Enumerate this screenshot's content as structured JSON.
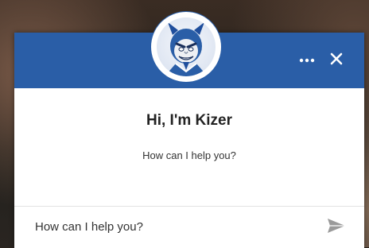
{
  "chat": {
    "greeting": "Hi, I'm Kizer",
    "prompt": "How can I help you?",
    "input_placeholder": "How can I help you?"
  },
  "header": {
    "avatar_icon": "blue-devil-mascot-icon",
    "more_icon": "more-horizontal-icon",
    "close_icon": "close-icon"
  },
  "composer": {
    "send_icon": "send-icon"
  },
  "colors": {
    "header": "#2a5ea7",
    "send_icon": "#9a9a9a"
  }
}
